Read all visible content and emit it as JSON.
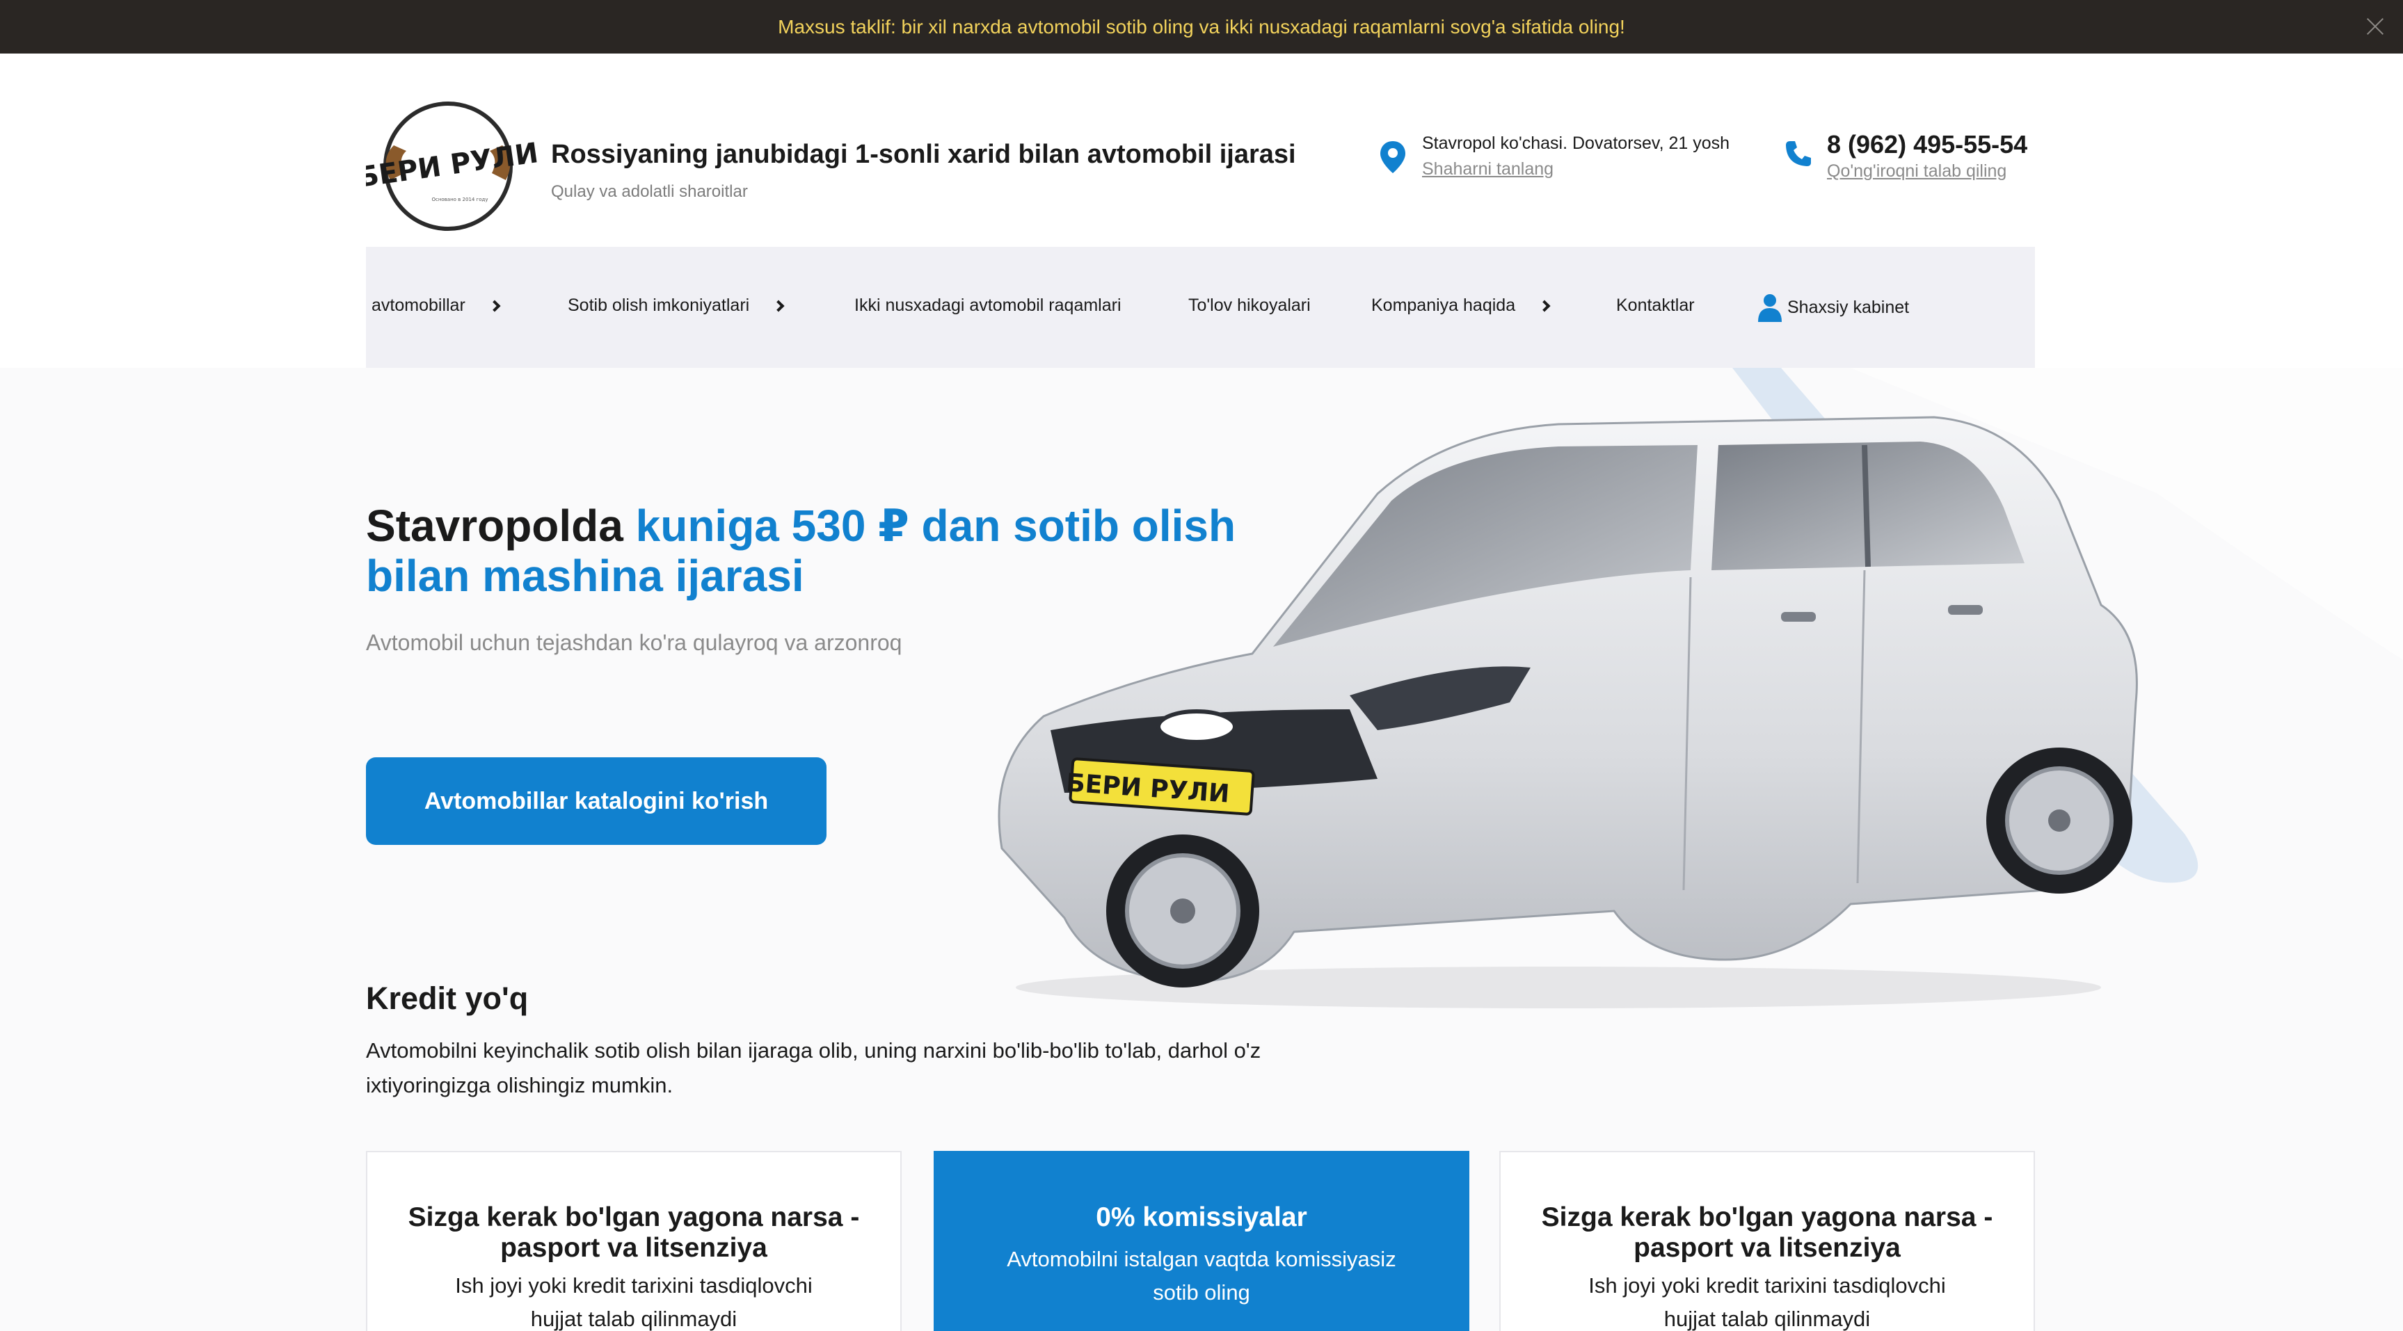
{
  "promo": {
    "text": "Maxsus taklif: bir xil narxda avtomobil sotib oling va ikki nusxadagi raqamlarni sovg'a sifatida oling!"
  },
  "header": {
    "logo_text": "БЕРИ РУЛИ",
    "logo_small": "Основано в 2014 году",
    "title": "Rossiyaning janubidagi 1-sonli xarid bilan avtomobil ijarasi",
    "subtitle": "Qulay va adolatli sharoitlar",
    "address": "Stavropol ko'chasi. Dovatorsev, 21 yosh",
    "city_link": "Shaharni tanlang",
    "phone": "8 (962) 495-55-54",
    "callback": "Qo'ng'iroqni talab qiling"
  },
  "nav": {
    "items": [
      {
        "label": "avtomobillar",
        "has_submenu": true
      },
      {
        "label": "Sotib olish imkoniyatlari",
        "has_submenu": true
      },
      {
        "label": "Ikki nusxadagi avtomobil raqamlari",
        "has_submenu": false
      },
      {
        "label": "To'lov hikoyalari",
        "has_submenu": false
      },
      {
        "label": "Kompaniya haqida",
        "has_submenu": true
      },
      {
        "label": "Kontaktlar",
        "has_submenu": false
      },
      {
        "label": "Shaxsiy kabinet",
        "has_submenu": false
      }
    ]
  },
  "hero": {
    "title_plain": "Stavropolda ",
    "title_accent": "kuniga 530 ₽ dan sotib olish bilan mashina ijarasi",
    "subtitle": "Avtomobil uchun tejashdan ko'ra qulayroq va arzonroq",
    "cta": "Avtomobillar katalogini ko'rish",
    "plate": "БЕРИ РУЛИ"
  },
  "credit": {
    "title": "Kredit yo'q",
    "text": "Avtomobilni keyinchalik sotib olish bilan ijaraga olib, uning narxini bo'lib-bo'lib to'lab, darhol o'z ixtiyoringizga olishingiz mumkin."
  },
  "cards": [
    {
      "title": "Sizga kerak bo'lgan yagona narsa - pasport va litsenziya",
      "text": "Ish joyi yoki kredit tarixini tasdiqlovchi hujjat talab qilinmaydi"
    },
    {
      "title": "0% komissiyalar",
      "text": "Avtomobilni istalgan vaqtda komissiyasiz sotib oling"
    },
    {
      "title": "Sizga kerak bo'lgan yagona narsa - pasport va litsenziya",
      "text": "Ish joyi yoki kredit tarixini tasdiqlovchi hujjat talab qilinmaydi"
    }
  ],
  "colors": {
    "accent": "#1181cf",
    "promo_bg": "#2a2623",
    "promo_text": "#f3d35c",
    "nav_bg": "#f0f0f5"
  }
}
